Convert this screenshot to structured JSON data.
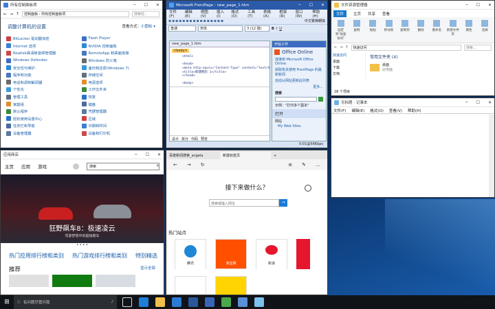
{
  "cp": {
    "title": "所有控制面板项",
    "path": "控制面板 › 所有控制面板项",
    "search": "搜索控...",
    "heading": "调整计算机的设置",
    "view_label": "查看方式：",
    "view_value": "小图标 ▾",
    "left": [
      "BitLocker 驱动器加密",
      "Internet 选项",
      "Realtek高清晰音频管理器",
      "Windows Defender",
      "安全性与维护",
      "程序和功能",
      "电话和调制解调器",
      "个性化",
      "管理工具",
      "家庭组",
      "默认程序",
      "轻松使用设置中心",
      "任务栏和导航",
      "设备管理器"
    ],
    "right": [
      "Flash Player",
      "NVIDIA 控制面板",
      "RemoteApp 和桌面连接",
      "Windows 防火墙",
      "备份和还原(Windows 7)",
      "存储空间",
      "电源选项",
      "工作文件夹",
      "恢复",
      "键盘",
      "凭据管理器",
      "区域",
      "日期和时间",
      "设备和打印机"
    ]
  },
  "fp": {
    "title": "Microsoft FrontPage - new_page_1.htm",
    "menu": [
      "文件(F)",
      "编辑(E)",
      "视图(V)",
      "插入(I)",
      "格式(O)",
      "工具(T)",
      "表格(A)",
      "框架(R)",
      "窗口(W)",
      "帮助(H)"
    ],
    "style": "普通",
    "font": "宋体",
    "size": "3 (12 磅)",
    "help_hint": "中文繁簡轉換",
    "tab": "new_page_1.htm",
    "tag": "<body>",
    "code": [
      "<html>",
      "",
      "<head>",
      "<meta http-equiv=\"Content-Type\" content=\"text/h",
      "<title>新建网页 1</title>",
      "</head>",
      "",
      "<body>"
    ],
    "pane_title": "开始工作",
    "office": "Office Online",
    "links": [
      "连接到 Microsoft Office Online",
      "获取有关使用 FrontPage 的最新新闻",
      "自动从网站更新此列表"
    ],
    "more": "更多...",
    "search_label": "搜索",
    "example": "示例：\"打印多个副本\"",
    "open_label": "打开",
    "sites": "网站",
    "site1": "My Web Sites",
    "views": [
      "设计",
      "拆分",
      "代码",
      "预览"
    ],
    "status": "0:01@56Kbps"
  },
  "fe": {
    "title": "文件资源管理器",
    "tabs": [
      "文件",
      "主页",
      "共享",
      "查看"
    ],
    "ribbon": [
      "固定到\"快速访问\"",
      "复制",
      "粘贴",
      "移动到",
      "复制到",
      "删除",
      "重命名",
      "新建文件夹",
      "属性",
      "选择"
    ],
    "groups": [
      "剪贴板",
      "组织",
      "新建",
      "打开"
    ],
    "path": "快速访问",
    "search": "搜索...",
    "nav": [
      "快速访问",
      "桌面",
      "下载",
      "文档"
    ],
    "section": "常用文件夹 (4)",
    "folder": "桌面",
    "folder_sub": "此电脑",
    "status": "28 个项目"
  },
  "np": {
    "title": "无标题 - 记事本",
    "menu": [
      "文件(F)",
      "编辑(E)",
      "格式(O)",
      "查看(V)",
      "帮助(H)"
    ]
  },
  "st": {
    "title": "应用商店",
    "nav": [
      "主页",
      "应用",
      "游戏"
    ],
    "search": "搜索",
    "hero_title": "狂野飙车8：极速凌云",
    "hero_sub": "驾驶梦想中的超级跑车",
    "links": [
      "热门应用排行榜和类别",
      "热门游戏排行榜和类别",
      "特别精选"
    ],
    "rec": "推荐",
    "show_all": "显示全部"
  },
  "ed": {
    "tabs": [
      "百度新闻搜索_angela",
      "新建标签页"
    ],
    "heading": "接下来做什么？",
    "search": "搜索或输入网址",
    "hot": "热门站点",
    "tiles": [
      {
        "label": "腾讯",
        "color": "#1f88d6"
      },
      {
        "label": "淘宝网",
        "color": "#ff5000"
      },
      {
        "label": "新浪",
        "color": "#e6162d"
      }
    ],
    "tiles2": [
      {
        "label": "",
        "color": "#ffffff"
      },
      {
        "label": "",
        "color": "#ffd400"
      }
    ]
  },
  "taskbar": {
    "search": "有问题尽管问我"
  }
}
